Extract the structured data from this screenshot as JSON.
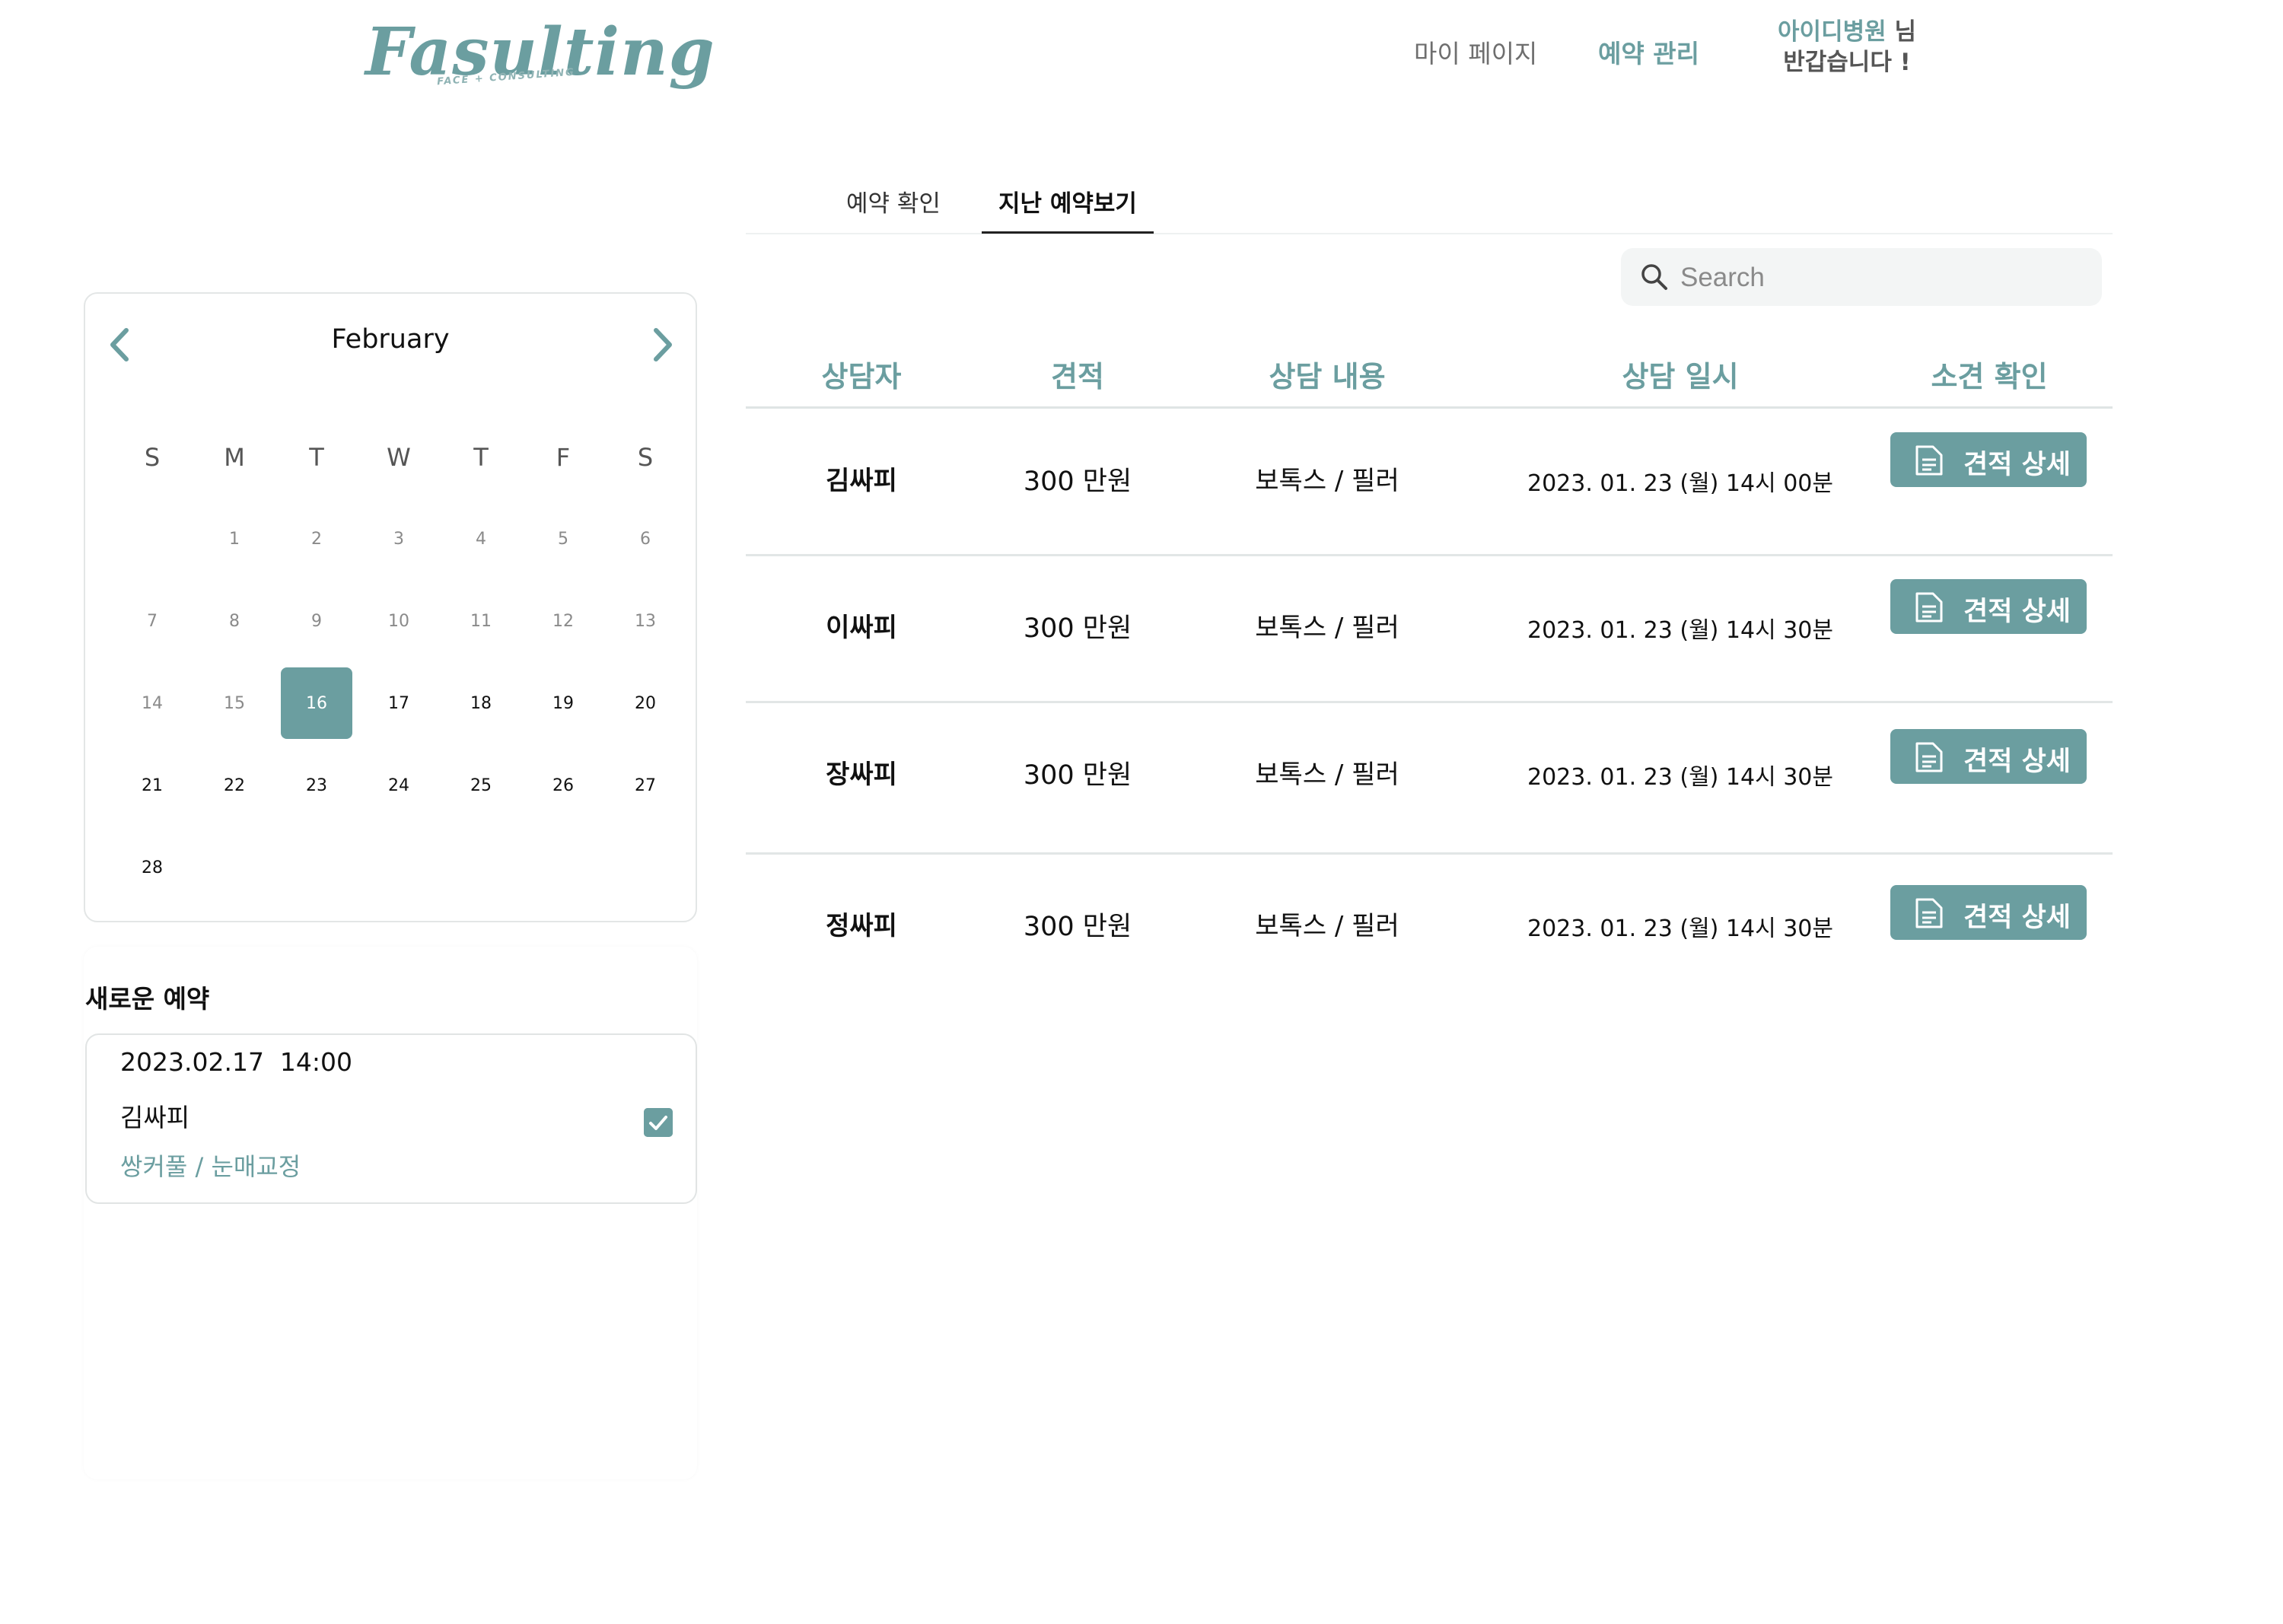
{
  "header": {
    "logo_text": "Fasulting",
    "logo_sub": "FACE + CONSULTING",
    "nav": {
      "mypage": "마이 페이지",
      "reservation": "예약 관리"
    },
    "greeting_user": "아이디병원",
    "greeting_suffix": "님",
    "greeting_line2": "반갑습니다 !"
  },
  "tabs": {
    "confirm": "예약 확인",
    "history": "지난 예약보기"
  },
  "search": {
    "placeholder": "Search"
  },
  "table": {
    "headers": [
      "상담자",
      "견적",
      "상담 내용",
      "상담 일시",
      "소견 확인"
    ],
    "rows": [
      {
        "name": "김싸피",
        "estimate": "300 만원",
        "content": "보톡스 / 필러",
        "datetime": "2023. 01. 23 (월) 14시 00분",
        "button": "견적 상세"
      },
      {
        "name": "이싸피",
        "estimate": "300 만원",
        "content": "보톡스 / 필러",
        "datetime": "2023. 01. 23 (월) 14시 30분",
        "button": "견적 상세"
      },
      {
        "name": "장싸피",
        "estimate": "300 만원",
        "content": "보톡스 / 필러",
        "datetime": "2023. 01. 23 (월) 14시 30분",
        "button": "견적 상세"
      },
      {
        "name": "정싸피",
        "estimate": "300 만원",
        "content": "보톡스 / 필러",
        "datetime": "2023. 01. 23 (월) 14시 30분",
        "button": "견적 상세"
      }
    ]
  },
  "calendar": {
    "month": "February",
    "weekdays": [
      "S",
      "M",
      "T",
      "W",
      "T",
      "F",
      "S"
    ],
    "days": [
      "1",
      "2",
      "3",
      "4",
      "5",
      "6",
      "7",
      "8",
      "9",
      "10",
      "11",
      "12",
      "13",
      "14",
      "15",
      "16",
      "17",
      "18",
      "19",
      "20",
      "21",
      "22",
      "23",
      "24",
      "25",
      "26",
      "27",
      "28"
    ],
    "first_weekday_index": 1,
    "selected_day": "16"
  },
  "new_reservation": {
    "title": "새로운 예약",
    "datetime": "2023.02.17  14:00",
    "name": "김싸피",
    "procedure": "쌍커풀 / 눈매교정",
    "checked": true
  },
  "colors": {
    "accent": "#6b9ea0"
  },
  "icons": [
    "search-icon",
    "chevron-left-icon",
    "chevron-right-icon",
    "document-icon",
    "checkbox-icon"
  ]
}
